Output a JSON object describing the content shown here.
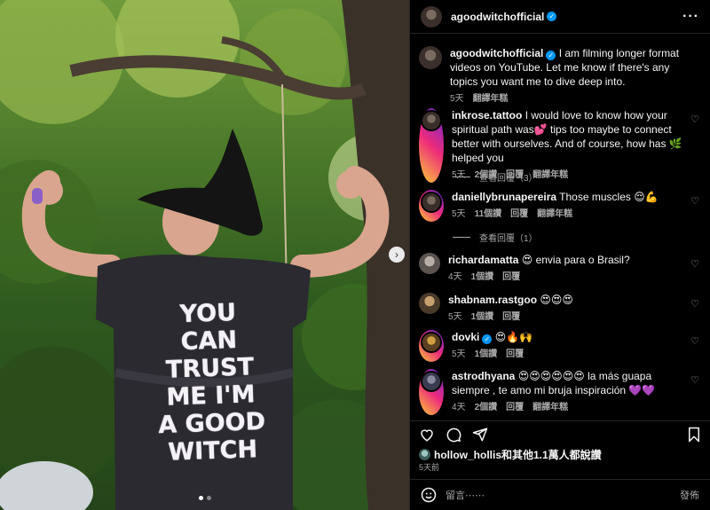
{
  "post": {
    "author": "agoodwitchofficial",
    "more_icon": "more-horizontal-icon",
    "shirt_lines": [
      "YOU CAN",
      "TRUST",
      "ME I'M",
      "A GOOD",
      "WITCH"
    ],
    "carousel": {
      "count": 2,
      "active": 1
    }
  },
  "caption": {
    "username": "agoodwitchofficial",
    "text": "I am filming longer format videos on YouTube. Let me know if there's any topics you want me to dive deep into.",
    "time": "5天",
    "translate": "翻譯年糕"
  },
  "comments": [
    {
      "username": "inkrose.tattoo",
      "text": "I would love to know how your spiritual path was💕 tips too maybe to connect better with ourselves. And of course, how has 🌿 helped you",
      "time": "5天",
      "likes": "2個讚",
      "reply": "回覆",
      "translate": "翻譯年糕",
      "view_replies": "查看回覆（3）"
    },
    {
      "username": "daniellybrunapereira",
      "text": "Those muscles 😌💪",
      "time": "5天",
      "likes": "11個讚",
      "reply": "回覆",
      "translate": "翻譯年糕",
      "view_replies": "查看回覆（1）"
    },
    {
      "username": "richardamatta",
      "text": "😍 envia para o Brasil?",
      "time": "4天",
      "likes": "1個讚",
      "reply": "回覆"
    },
    {
      "username": "shabnam.rastgoo",
      "text": "😍😍😍",
      "time": "5天",
      "likes": "1個讚",
      "reply": "回覆"
    },
    {
      "username": "dovki",
      "text": "😍🔥🙌",
      "time": "5天",
      "likes": "1個讚",
      "reply": "回覆"
    },
    {
      "username": "astrodhyana",
      "text": "😍😍😍😍😍😍 la más guapa siempre , te amo mi bruja inspiración 💜💜",
      "time": "4天",
      "likes": "2個讚",
      "reply": "回覆",
      "translate": "翻譯年糕"
    }
  ],
  "actions": {
    "like": "heart-icon",
    "comment": "comment-icon",
    "share": "share-icon",
    "save": "bookmark-icon"
  },
  "likes_text": "hollow_hollis和其他1.1萬人都說讚",
  "time_ago": "5天前",
  "composer": {
    "placeholder": "留言⋯⋯",
    "post": "發佈"
  },
  "colors": {
    "accent": "#0095f6",
    "panel_bg": "#000000",
    "muted": "#a8a8a8"
  }
}
